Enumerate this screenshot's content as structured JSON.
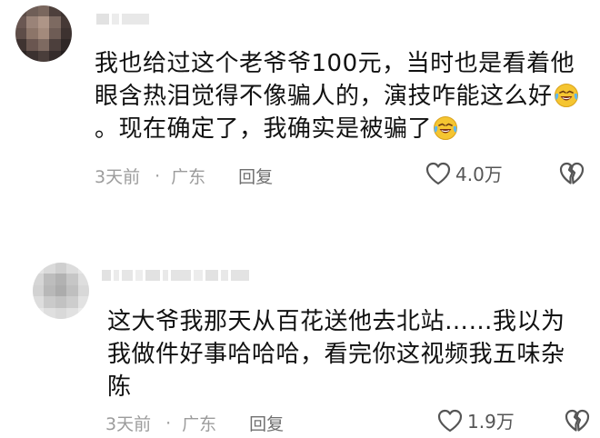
{
  "comments": [
    {
      "username": "",
      "text_parts": [
        "我也给过这个老爷爷100元，当时也是看着他眼含热泪觉得不像骗人的，演技咋能这么好",
        "。现在确定了，我确实是被骗了"
      ],
      "emoji": "laughing-crying-emoji",
      "time": "3天前",
      "separator": "·",
      "location": "广东",
      "reply_label": "回复",
      "likes": "4.0万"
    },
    {
      "username": "",
      "text": "这大爷我那天从百花送他去北站……我以为我做件好事哈哈哈，看完你这视频我五味杂陈",
      "time": "3天前",
      "separator": "·",
      "location": "广东",
      "reply_label": "回复",
      "likes": "1.9万"
    }
  ],
  "icons": {
    "like": "heart-outline-icon",
    "dislike": "broken-heart-icon"
  },
  "colors": {
    "text": "#111111",
    "meta": "#9c9c9c",
    "icon": "#555555",
    "emoji_face": "#f5c531"
  }
}
